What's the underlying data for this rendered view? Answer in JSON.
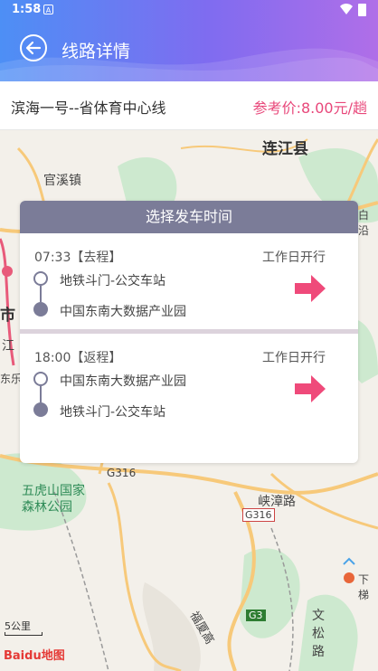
{
  "status_bar": {
    "time": "1:58",
    "notification_icon": "A"
  },
  "header": {
    "title": "线路详情",
    "back_icon": "back-arrow-icon"
  },
  "route": {
    "name": "滨海一号--省体育中心线",
    "price": "参考价:8.00元/趟"
  },
  "map": {
    "labels": [
      "连江县",
      "官溪镇",
      "市",
      "江",
      "东乐",
      "五虎山国家",
      "森林公园",
      "峡漳路",
      "G316",
      "G316",
      "G3",
      "文",
      "松",
      "路",
      "下梯",
      "福厦高",
      "白沿"
    ],
    "scale": "5公里",
    "provider": "Baidu地图"
  },
  "schedule": {
    "title": "选择发车时间",
    "trips": [
      {
        "time": "07:33【去程】",
        "note": "工作日开行",
        "from": "地铁斗门-公交车站",
        "to": "中国东南大数据产业园"
      },
      {
        "time": "18:00【返程】",
        "note": "工作日开行",
        "from": "中国东南大数据产业园",
        "to": "地铁斗门-公交车站"
      }
    ]
  },
  "colors": {
    "accent": "#e8477a",
    "header_start": "#4d8ff5",
    "header_end": "#b06ee8",
    "card_header": "#7b7c98"
  }
}
